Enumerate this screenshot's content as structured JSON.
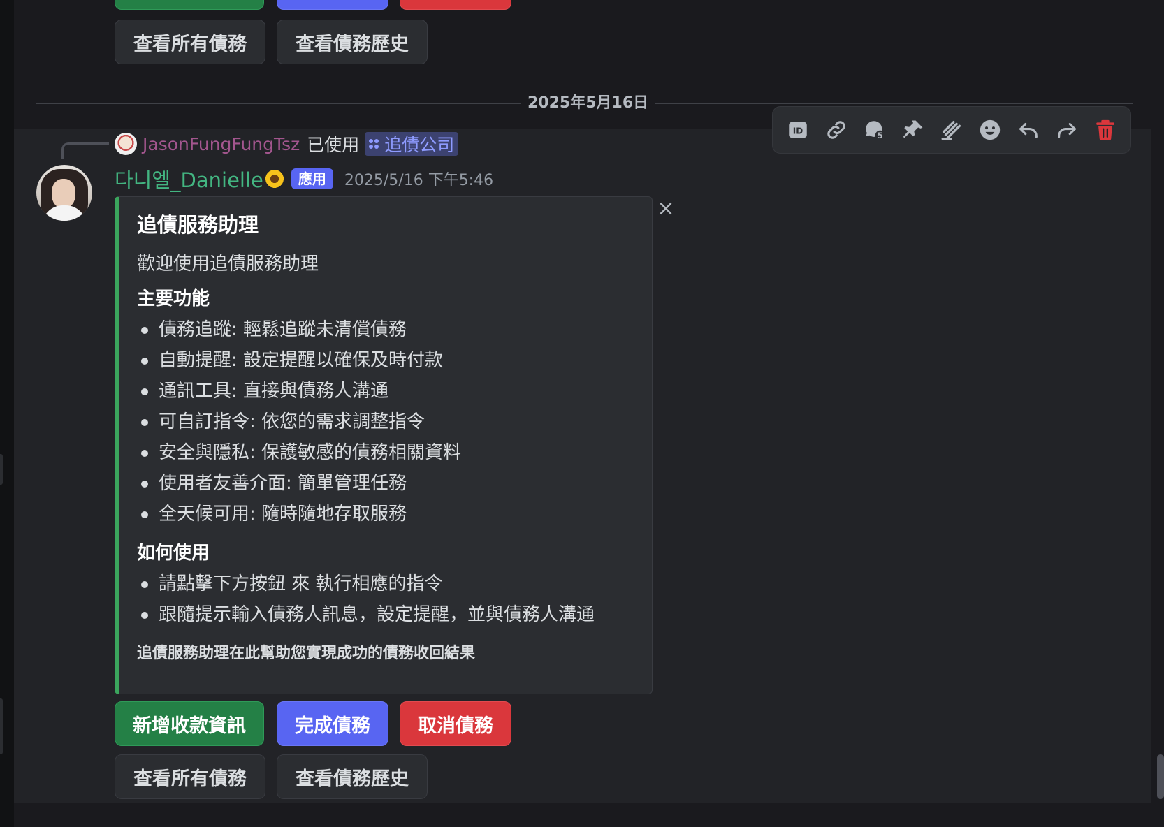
{
  "top_buttons": {
    "view_all": "查看所有債務",
    "view_history": "查看債務歷史"
  },
  "date_divider": "2025年5月16日",
  "reply": {
    "user": "JasonFungFungTsz",
    "verb": "已使用",
    "command": "追債公司"
  },
  "message": {
    "author": "다니엘_Danielle",
    "badge": "應用",
    "timestamp": "2025/5/16 下午5:46"
  },
  "embed": {
    "title": "追債服務助理",
    "description": "歡迎使用追債服務助理",
    "features_heading": "主要功能",
    "features": [
      "債務追蹤: 輕鬆追蹤未清償債務",
      "自動提醒: 設定提醒以確保及時付款",
      "通訊工具: 直接與債務人溝通",
      "可自訂指令: 依您的需求調整指令",
      "安全與隱私: 保護敏感的債務相關資料",
      "使用者友善介面: 簡單管理任務",
      "全天候可用: 隨時隨地存取服務"
    ],
    "usage_heading": "如何使用",
    "usage": [
      "請點擊下方按鈕 來 執行相應的指令",
      "跟隨提示輸入債務人訊息，設定提醒，並與債務人溝通"
    ],
    "footer": "追債服務助理在此幫助您實現成功的債務收回結果"
  },
  "buttons": {
    "add_payment": "新增收款資訊",
    "complete": "完成債務",
    "cancel": "取消債務",
    "view_all": "查看所有債務",
    "view_history": "查看債務歷史"
  },
  "toolbar_icons": [
    "id-icon",
    "link-icon",
    "thread-icon",
    "pin-icon",
    "stack-icon",
    "emoji-icon",
    "reply-icon",
    "forward-icon",
    "trash-icon"
  ],
  "colors": {
    "green": "#248046",
    "blue": "#5865f2",
    "red": "#da373c",
    "embed_accent": "#3ba55d",
    "author": "#43b581",
    "delete": "#da373c"
  }
}
